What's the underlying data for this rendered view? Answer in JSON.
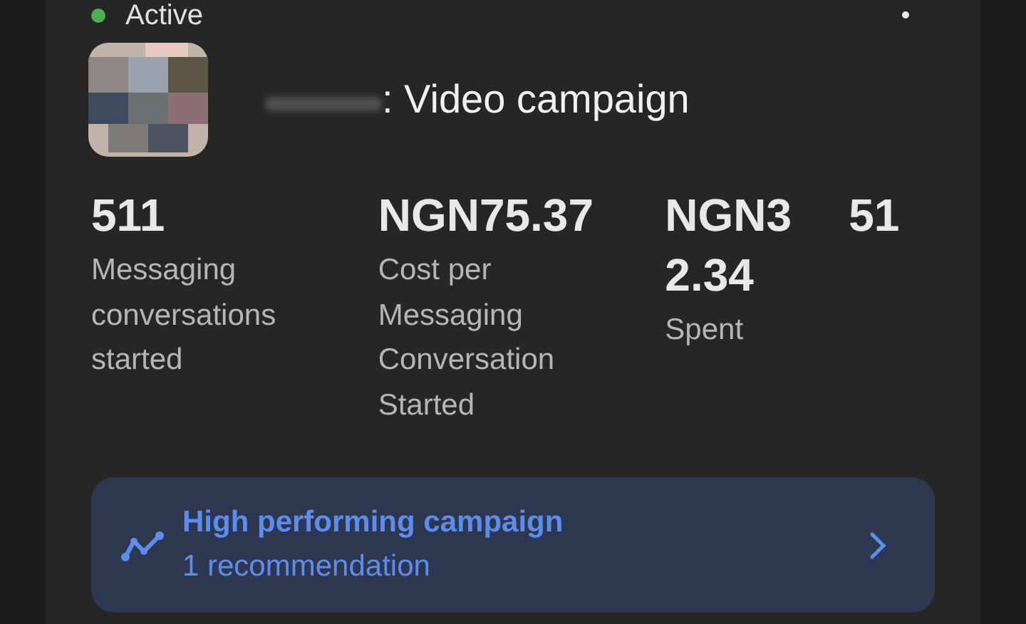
{
  "status": {
    "label": "Active",
    "color": "#4caf50"
  },
  "campaign": {
    "title": ": Video campaign"
  },
  "stats": [
    {
      "value_lines": [
        [
          "511"
        ]
      ],
      "label": "Messaging conversations started"
    },
    {
      "value_lines": [
        [
          "NGN75.37"
        ]
      ],
      "label": "Cost per Messaging Conversation Started"
    },
    {
      "value_lines": [
        [
          "NGN3",
          "51"
        ],
        [
          "2.34"
        ]
      ],
      "label": "Spent"
    }
  ],
  "recommendation": {
    "title": "High performing campaign",
    "subtitle": "1 recommendation"
  }
}
